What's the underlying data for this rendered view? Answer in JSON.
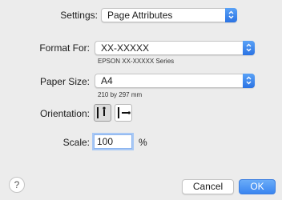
{
  "settings": {
    "label": "Settings:",
    "value": "Page Attributes"
  },
  "format_for": {
    "label": "Format For:",
    "value": "XX-XXXXX",
    "subtitle": "EPSON XX-XXXXX Series"
  },
  "paper_size": {
    "label": "Paper Size:",
    "value": "A4",
    "subtitle": "210 by 297 mm"
  },
  "orientation": {
    "label": "Orientation:",
    "options": [
      "portrait",
      "landscape"
    ],
    "selected": "portrait"
  },
  "scale": {
    "label": "Scale:",
    "value": "100",
    "unit": "%"
  },
  "buttons": {
    "help": "?",
    "cancel": "Cancel",
    "ok": "OK"
  },
  "colors": {
    "accent": "#3a85f0",
    "background": "#ececec"
  }
}
